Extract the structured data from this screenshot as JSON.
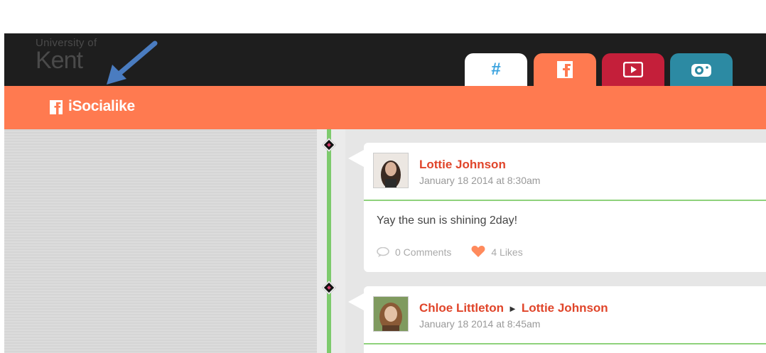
{
  "brand": {
    "line1": "University of",
    "line2": "Kent"
  },
  "tabs": [
    {
      "name": "hashtag",
      "label": "#",
      "color": "#ffffff"
    },
    {
      "name": "facebook",
      "icon": "facebook-icon",
      "color": "#ff7a50"
    },
    {
      "name": "youtube",
      "icon": "play-icon",
      "color": "#c41f3a"
    },
    {
      "name": "instagram",
      "icon": "camera-icon",
      "color": "#2c8aa3"
    }
  ],
  "header": {
    "title": "iSocialike",
    "icon": "facebook-icon"
  },
  "colors": {
    "accent": "#ff7a50",
    "timeline": "#7ecb6d",
    "name": "#e0452a"
  },
  "posts": [
    {
      "author": "Lottie Johnson",
      "date": "January 18 2014 at 8:30am",
      "message": "Yay the sun is shining 2day!",
      "comments": "0 Comments",
      "likes": "4 Likes"
    },
    {
      "author": "Chloe Littleton",
      "arrow": "►",
      "recipient": "Lottie Johnson",
      "date": "January 18 2014 at 8:45am"
    }
  ]
}
